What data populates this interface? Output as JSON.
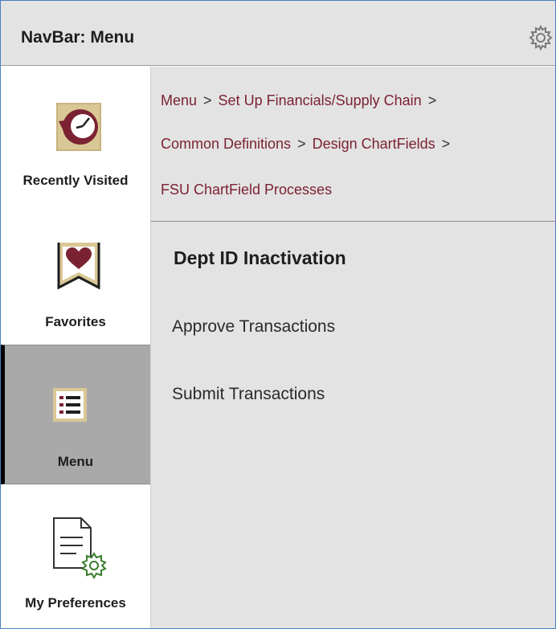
{
  "header": {
    "title": "NavBar: Menu",
    "gear_icon": "gear-icon"
  },
  "sidebar": {
    "items": [
      {
        "label": "Recently Visited",
        "icon": "recent-clock-icon",
        "active": false
      },
      {
        "label": "Favorites",
        "icon": "favorite-heart-icon",
        "active": false
      },
      {
        "label": "Menu",
        "icon": "menu-list-icon",
        "active": true
      },
      {
        "label": "My Preferences",
        "icon": "preferences-document-gear-icon",
        "active": false
      }
    ]
  },
  "breadcrumb": {
    "items": [
      "Menu",
      "Set Up Financials/Supply Chain",
      "Common Definitions",
      "Design ChartFields",
      "FSU ChartField Processes"
    ],
    "separator": ">"
  },
  "main": {
    "section_title": "Dept ID Inactivation",
    "links": [
      "Approve Transactions",
      "Submit Transactions"
    ]
  },
  "colors": {
    "accent": "#7b2232",
    "gold": "#c9b37e",
    "header_bg": "#e3e3e3",
    "active_bg": "#a9a9a9"
  }
}
